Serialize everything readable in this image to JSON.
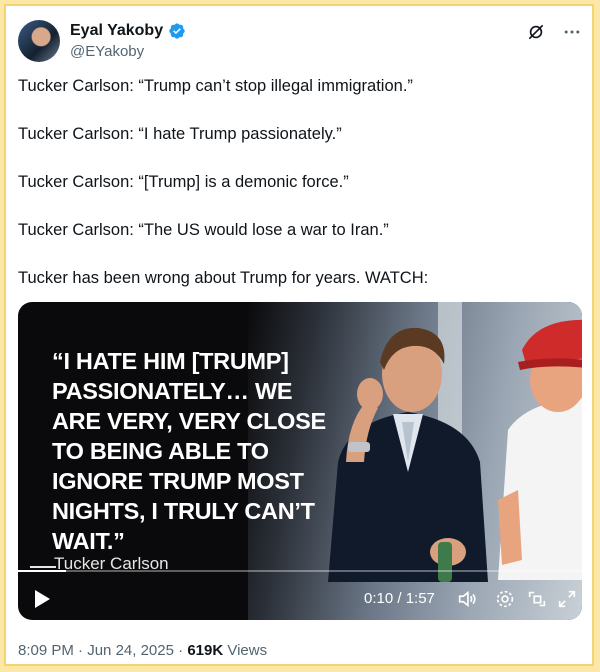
{
  "author": {
    "name": "Eyal Yakoby",
    "handle": "@EYakoby"
  },
  "tweet": {
    "lines": [
      "Tucker Carlson: “Trump can’t stop illegal immigration.”",
      "Tucker Carlson: “I hate Trump passionately.”",
      "Tucker Carlson: “[Trump] is a demonic force.”",
      "Tucker Carlson: “The US would lose a war to Iran.”",
      "Tucker has been wrong about Trump for years. WATCH:"
    ]
  },
  "video": {
    "quote_lines": [
      "“I HATE HIM [TRUMP]",
      "PASSIONATELY… WE",
      "ARE VERY, VERY CLOSE",
      "TO BEING ABLE TO",
      "IGNORE TRUMP MOST",
      "NIGHTS, I TRULY CAN’T",
      "WAIT.”"
    ],
    "attribution": "Tucker Carlson",
    "time_display": "0:10 / 1:57",
    "progress_fraction": 0.085
  },
  "meta": {
    "time": "8:09 PM",
    "date": "Jun 24, 2025",
    "views_count": "619K",
    "views_label": "Views"
  },
  "colors": {
    "verified": "#1d9bf0",
    "frame": "#f2d471"
  },
  "icons": [
    "verified-badge-icon",
    "grok-icon",
    "more-icon",
    "play-icon",
    "volume-icon",
    "settings-icon",
    "pip-icon",
    "fullscreen-icon"
  ]
}
